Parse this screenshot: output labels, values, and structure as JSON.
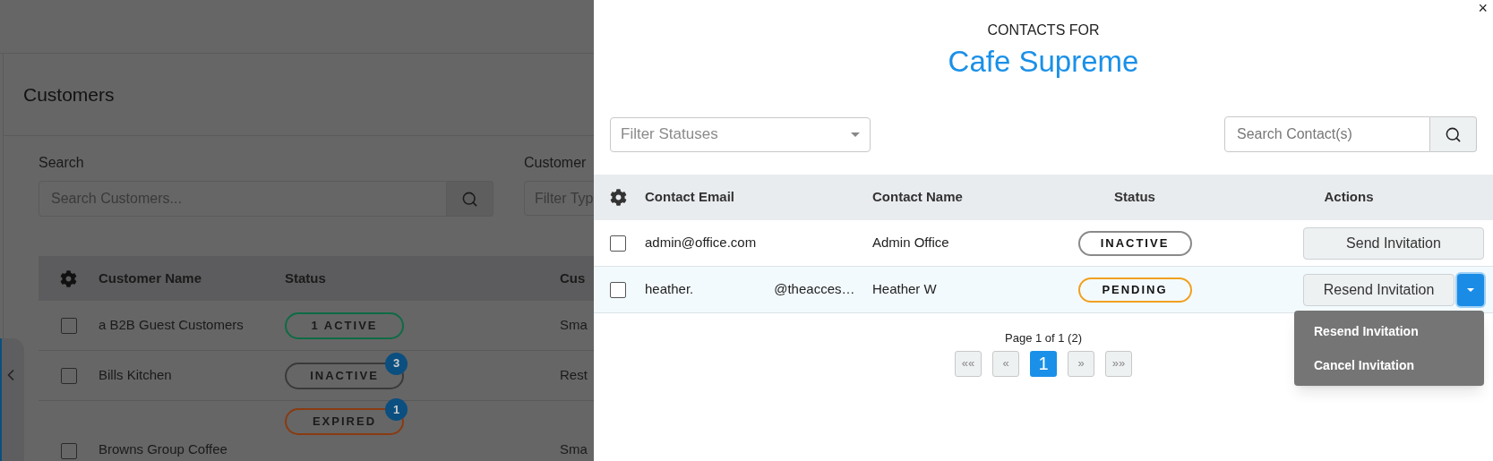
{
  "background_page": {
    "title": "Customers",
    "search": {
      "label": "Search",
      "placeholder": "Search Customers..."
    },
    "filter": {
      "label": "Customer",
      "placeholder": "Filter Typ"
    },
    "table": {
      "columns": [
        "Customer Name",
        "Status",
        "Cus"
      ],
      "rows": [
        {
          "name": "a B2B Guest Customers",
          "status": {
            "label": "1 ACTIVE",
            "kind": "active"
          },
          "column_3": "Sma",
          "checked": false
        },
        {
          "name": "Bills Kitchen",
          "status": {
            "label": "INACTIVE",
            "kind": "inactive"
          },
          "badge": "3",
          "column_3": "Rest",
          "checked": false
        },
        {
          "name": "Browns Group Coffee",
          "status": {
            "label": "EXPIRED",
            "kind": "expired"
          },
          "badge": "1",
          "column_3": "Sma",
          "checked": false
        }
      ]
    }
  },
  "panel": {
    "close": "×",
    "subtitle": "CONTACTS FOR",
    "title": "Cafe Supreme",
    "filter": {
      "placeholder": "Filter Statuses"
    },
    "search": {
      "placeholder": "Search Contact(s)"
    },
    "table": {
      "columns": [
        "Contact Email",
        "Contact Name",
        "Status",
        "Actions"
      ],
      "rows": [
        {
          "email_parts": [
            "admin@office.com"
          ],
          "name": "Admin Office",
          "status": {
            "label": "INACTIVE",
            "kind": "inactive"
          },
          "action": "Send Invitation",
          "has_menu": false,
          "checked": false,
          "highlighted": false
        },
        {
          "email_parts": [
            "heather.",
            "@theacces…"
          ],
          "name": "Heather W",
          "status": {
            "label": "PENDING",
            "kind": "pending"
          },
          "action": "Resend Invitation",
          "has_menu": true,
          "checked": false,
          "highlighted": true
        }
      ]
    },
    "pagination": {
      "summary": "Page 1 of 1 (2)",
      "buttons": [
        {
          "label": "««",
          "selected": false
        },
        {
          "label": "«",
          "selected": false
        },
        {
          "label": "1",
          "selected": true
        },
        {
          "label": "»",
          "selected": false
        },
        {
          "label": "»»",
          "selected": false
        }
      ]
    },
    "menu": {
      "items": [
        "Resend Invitation",
        "Cancel Invitation"
      ]
    }
  }
}
